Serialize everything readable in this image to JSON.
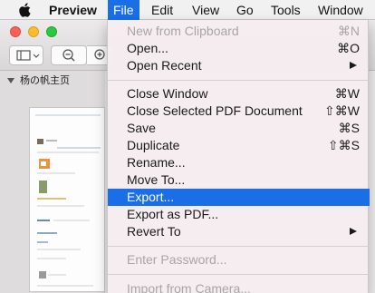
{
  "menubar": {
    "apple_icon": "apple-logo-icon",
    "items": [
      {
        "label": "Preview",
        "active": false,
        "bold": true
      },
      {
        "label": "File",
        "active": true,
        "bold": false
      },
      {
        "label": "Edit",
        "active": false,
        "bold": false
      },
      {
        "label": "View",
        "active": false,
        "bold": false
      },
      {
        "label": "Go",
        "active": false,
        "bold": false
      },
      {
        "label": "Tools",
        "active": false,
        "bold": false
      },
      {
        "label": "Window",
        "active": false,
        "bold": false
      }
    ]
  },
  "sidebar": {
    "document_title": "杨の帆主页"
  },
  "file_menu": {
    "items": [
      {
        "label": "New from Clipboard",
        "shortcut": "⌘N",
        "disabled": true
      },
      {
        "label": "Open...",
        "shortcut": "⌘O",
        "disabled": false
      },
      {
        "label": "Open Recent",
        "shortcut": "",
        "disabled": false,
        "submenu": true
      },
      {
        "label": "Close Window",
        "shortcut": "⌘W",
        "disabled": false
      },
      {
        "label": "Close Selected PDF Document",
        "shortcut": "⇧⌘W",
        "disabled": false
      },
      {
        "label": "Save",
        "shortcut": "⌘S",
        "disabled": false
      },
      {
        "label": "Duplicate",
        "shortcut": "⇧⌘S",
        "disabled": false
      },
      {
        "label": "Rename...",
        "shortcut": "",
        "disabled": false
      },
      {
        "label": "Move To...",
        "shortcut": "",
        "disabled": false
      },
      {
        "label": "Export...",
        "shortcut": "",
        "disabled": false,
        "highlighted": true
      },
      {
        "label": "Export as PDF...",
        "shortcut": "",
        "disabled": false
      },
      {
        "label": "Revert To",
        "shortcut": "",
        "disabled": false,
        "submenu": true
      },
      {
        "label": "Enter Password...",
        "shortcut": "",
        "disabled": true
      },
      {
        "label": "Import from Camera...",
        "shortcut": "",
        "disabled": true
      }
    ]
  },
  "colors": {
    "accent": "#1a6fe6",
    "menu_bg": "#f5ecee",
    "disabled_text": "#a9a5a6"
  }
}
